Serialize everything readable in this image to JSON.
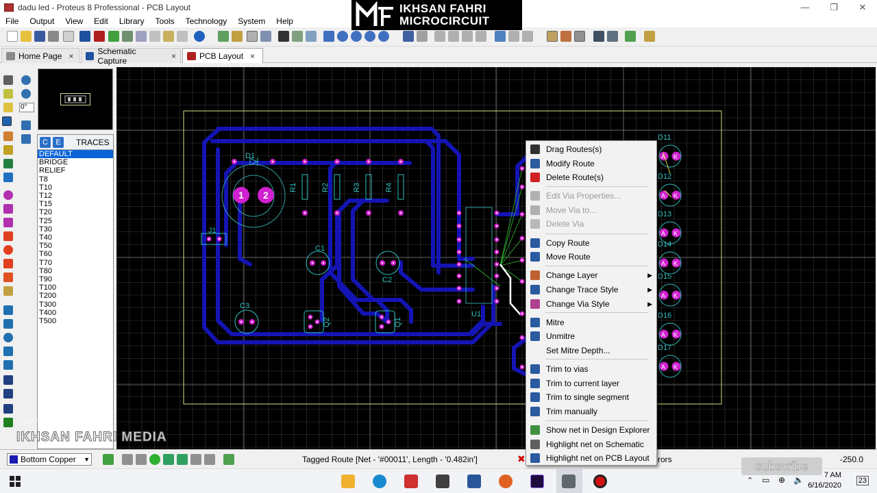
{
  "window": {
    "title": "dadu led - Proteus 8 Professional - PCB Layout",
    "minimize": "—",
    "maximize": "❐",
    "close": "✕"
  },
  "watermark": {
    "line1": "IKHSAN FAHRI",
    "line2": "MICROCIRCUIT"
  },
  "menu": [
    "File",
    "Output",
    "View",
    "Edit",
    "Library",
    "Tools",
    "Technology",
    "System",
    "Help"
  ],
  "tabs": [
    {
      "label": "Home Page",
      "close": "×"
    },
    {
      "label": "Schematic Capture",
      "close": "×"
    },
    {
      "label": "PCB Layout",
      "close": "×"
    }
  ],
  "rotation": {
    "value": "0°"
  },
  "traces": {
    "header": "TRACES",
    "items": [
      "DEFAULT",
      "BRIDGE",
      "RELIEF",
      "T8",
      "T10",
      "T12",
      "T15",
      "T20",
      "T25",
      "T30",
      "T40",
      "T50",
      "T60",
      "T70",
      "T80",
      "T90",
      "T100",
      "T200",
      "T300",
      "T400",
      "T500"
    ],
    "selected": "DEFAULT"
  },
  "overlay": {
    "support": "Support by:",
    "media": "IKHSAN FAHRI MEDIA"
  },
  "context_menu": {
    "items": [
      {
        "label": "Drag Routes(s)",
        "enabled": true
      },
      {
        "label": "Modify Route",
        "enabled": true
      },
      {
        "label": "Delete Route(s)",
        "enabled": true
      },
      {
        "label": "Edit Via Properties...",
        "enabled": false
      },
      {
        "label": "Move Via to...",
        "enabled": false
      },
      {
        "label": "Delete Via",
        "enabled": false
      },
      {
        "label": "Copy Route",
        "enabled": true
      },
      {
        "label": "Move Route",
        "enabled": true
      },
      {
        "label": "Change Layer",
        "enabled": true,
        "submenu": true
      },
      {
        "label": "Change Trace Style",
        "enabled": true,
        "submenu": true
      },
      {
        "label": "Change Via Style",
        "enabled": true,
        "submenu": true
      },
      {
        "label": "Mitre",
        "enabled": true
      },
      {
        "label": "Unmitre",
        "enabled": true
      },
      {
        "label": "Set Mitre Depth...",
        "enabled": true
      },
      {
        "label": "Trim to vias",
        "enabled": true
      },
      {
        "label": "Trim to current layer",
        "enabled": true
      },
      {
        "label": "Trim to single segment",
        "enabled": true
      },
      {
        "label": "Trim manually",
        "enabled": true
      },
      {
        "label": "Show net in Design Explorer",
        "enabled": true
      },
      {
        "label": "Highlight net on Schematic",
        "enabled": true
      },
      {
        "label": "Highlight net on PCB Layout",
        "enabled": true
      }
    ]
  },
  "pcb": {
    "labels": {
      "d1": "D1",
      "r1": "R1",
      "r2": "R2",
      "r3": "R3",
      "r4": "R4",
      "j1": "J1",
      "c1": "C1",
      "c2": "C2",
      "c3": "C3",
      "q1": "Q1",
      "q2": "Q2",
      "u1": "U1",
      "pad1": "1",
      "pad2": "2"
    },
    "leds": [
      "D11",
      "D12",
      "D13",
      "D14",
      "D15",
      "D16",
      "D17"
    ],
    "pad_a": "A",
    "pad_k": "K"
  },
  "status": {
    "layer": "Bottom Copper",
    "message": "Tagged Route [Net - '#00011', Length - '0.482in']",
    "errors": "rors",
    "coord": "-250.0"
  },
  "taskbar": {
    "time": "7 AM",
    "date": "6/16/2020",
    "notifications": "23"
  },
  "subscribe": "subscribe"
}
